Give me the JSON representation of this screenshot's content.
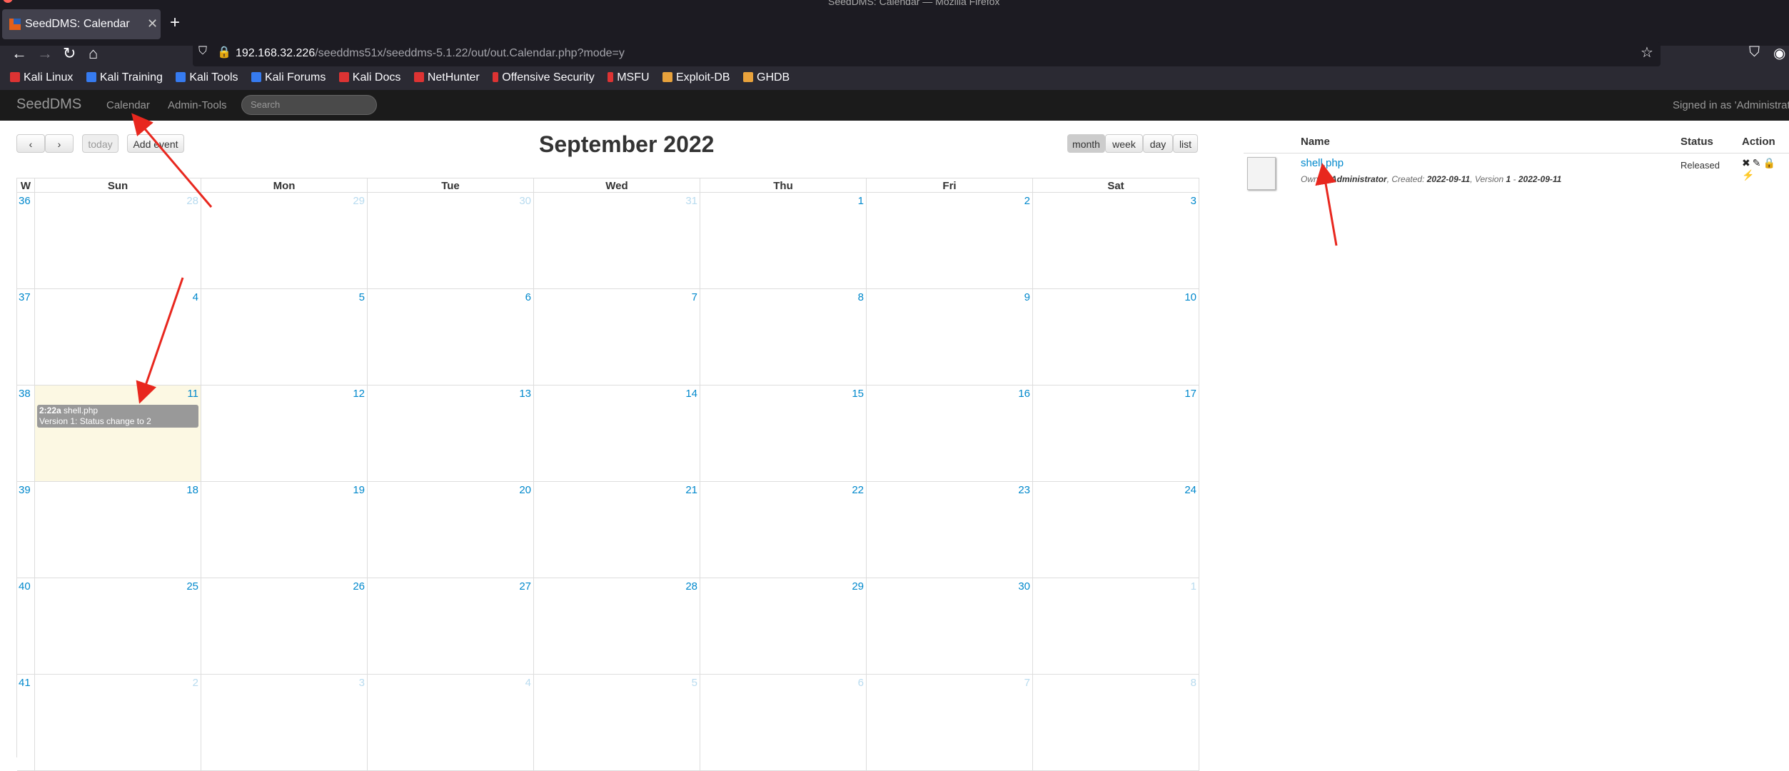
{
  "browser": {
    "window_title": "SeedDMS: Calendar — Mozilla Firefox",
    "tab_title": "SeedDMS: Calendar",
    "url_host": "192.168.32.226",
    "url_path": "/seeddms51x/seeddms-5.1.22/out/out.Calendar.php?mode=y",
    "bookmarks": [
      "Kali Linux",
      "Kali Training",
      "Kali Tools",
      "Kali Forums",
      "Kali Docs",
      "NetHunter",
      "Offensive Security",
      "MSFU",
      "Exploit-DB",
      "GHDB"
    ]
  },
  "app": {
    "brand": "SeedDMS",
    "nav": [
      "Calendar",
      "Admin-Tools"
    ],
    "search_placeholder": "Search",
    "signed_in": "Signed in as 'Administrator'"
  },
  "calendar": {
    "title": "September 2022",
    "prev_label": "‹",
    "next_label": "›",
    "today_label": "today",
    "add_event_label": "Add event",
    "views": [
      "month",
      "week",
      "day",
      "list"
    ],
    "active_view": "month",
    "headers": [
      "W",
      "Sun",
      "Mon",
      "Tue",
      "Wed",
      "Thu",
      "Fri",
      "Sat"
    ],
    "weeks": [
      {
        "wk": "36",
        "days": [
          "28",
          "29",
          "30",
          "31",
          "1",
          "2",
          "3"
        ],
        "other": [
          true,
          true,
          true,
          true,
          false,
          false,
          false
        ]
      },
      {
        "wk": "37",
        "days": [
          "4",
          "5",
          "6",
          "7",
          "8",
          "9",
          "10"
        ],
        "other": [
          false,
          false,
          false,
          false,
          false,
          false,
          false
        ]
      },
      {
        "wk": "38",
        "days": [
          "11",
          "12",
          "13",
          "14",
          "15",
          "16",
          "17"
        ],
        "other": [
          false,
          false,
          false,
          false,
          false,
          false,
          false
        ]
      },
      {
        "wk": "39",
        "days": [
          "18",
          "19",
          "20",
          "21",
          "22",
          "23",
          "24"
        ],
        "other": [
          false,
          false,
          false,
          false,
          false,
          false,
          false
        ]
      },
      {
        "wk": "40",
        "days": [
          "25",
          "26",
          "27",
          "28",
          "29",
          "30",
          "1"
        ],
        "other": [
          false,
          false,
          false,
          false,
          false,
          false,
          true
        ]
      },
      {
        "wk": "41",
        "days": [
          "2",
          "3",
          "4",
          "5",
          "6",
          "7",
          "8"
        ],
        "other": [
          true,
          true,
          true,
          true,
          true,
          true,
          true
        ]
      }
    ],
    "event": {
      "time": "2:22a",
      "name": "shell.php",
      "desc": "Version 1: Status change to 2"
    }
  },
  "doclist": {
    "headers": {
      "name": "Name",
      "status": "Status",
      "action": "Action"
    },
    "doc": {
      "name": "shell.php",
      "owner_label": "Owner: ",
      "owner": "Administrator",
      "created_label": ", Created: ",
      "created": "2022-09-11",
      "version_label": ", Version ",
      "version": "1",
      "version_sep": " - ",
      "version_date": "2022-09-11",
      "status": "Released",
      "actions": "✖✎🔒⚡"
    }
  }
}
